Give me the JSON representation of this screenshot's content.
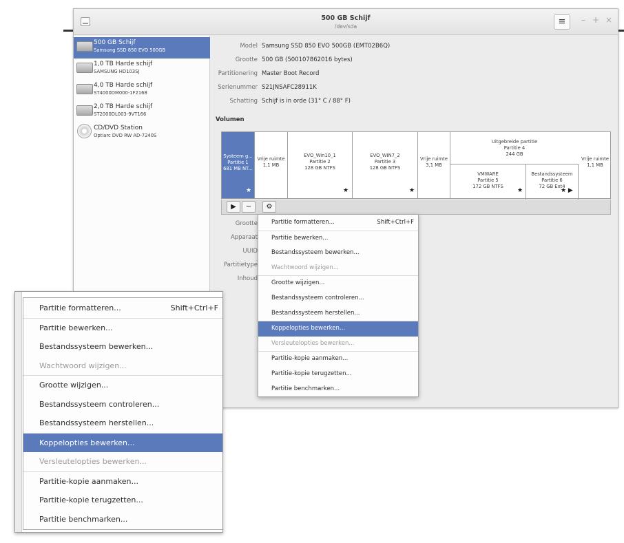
{
  "window": {
    "title": "500 GB Schijf",
    "subtitle": "/dev/sda",
    "menu_glyph": "≡",
    "controls": [
      "–",
      "+",
      "×"
    ]
  },
  "sidebar": {
    "drives": [
      {
        "name": "500 GB Schijf",
        "model": "Samsung SSD 850 EVO 500GB",
        "icon": "hard-disk-icon",
        "selected": true
      },
      {
        "name": "1,0 TB Harde schijf",
        "model": "SAMSUNG HD103SJ",
        "icon": "hard-disk-icon",
        "selected": false
      },
      {
        "name": "4,0 TB Harde schijf",
        "model": "ST4000DM000-1F2168",
        "icon": "hard-disk-icon",
        "selected": false
      },
      {
        "name": "2,0 TB Harde schijf",
        "model": "ST2000DL003-9VT166",
        "icon": "hard-disk-icon",
        "selected": false
      },
      {
        "name": "CD/DVD Station",
        "model": "Optiarc DVD RW AD-7240S",
        "icon": "optical-disc-icon",
        "selected": false
      }
    ]
  },
  "details": {
    "model_label": "Model",
    "model_value": "Samsung SSD 850 EVO 500GB (EMT02B6Q)",
    "size_label": "Grootte",
    "size_value": "500 GB (500107862016 bytes)",
    "partitioning_label": "Partitionering",
    "partitioning_value": "Master Boot Record",
    "serial_label": "Serienummer",
    "serial_value": "S21JNSAFC28911K",
    "assessment_label": "Schatting",
    "assessment_value": "Schijf is in orde (31° C / 88° F)"
  },
  "volumes": {
    "title": "Volumen",
    "segments": [
      {
        "l1": "Systeem g...",
        "l2": "Partitie 1",
        "l3": "681 MB NT...",
        "star": "★"
      },
      {
        "l1": "Vrije ruimte",
        "l2": "1,1 MB"
      },
      {
        "l1": "EVO_Win10_1",
        "l2": "Partitie 2",
        "l3": "128 GB NTFS",
        "star": "★"
      },
      {
        "l1": "EVO_WIN7_2",
        "l2": "Partitie 3",
        "l3": "128 GB NTFS",
        "star": "★"
      },
      {
        "l1": "Vrije ruimte",
        "l2": "3,1 MB"
      },
      {
        "l1": "Vrije ruimte",
        "l2": "1,1 MB"
      }
    ],
    "extended": {
      "l1": "Uitgebreide partitie",
      "l2": "Partitie 4",
      "l3": "244 GB"
    },
    "logical": [
      {
        "l1": "VMWARE",
        "l2": "Partitie 5",
        "l3": "172 GB NTFS",
        "star": "★"
      },
      {
        "l1": "Bestandssysteem",
        "l2": "Partitie 6",
        "l3": "72 GB Ext4",
        "star": "★ ▶"
      }
    ],
    "toolbar": {
      "play": "▶",
      "minus": "−",
      "gear": "⚙"
    }
  },
  "partition_details": {
    "labels": [
      "Grootte",
      "Apparaat",
      "UUID",
      "Partitietype",
      "Inhoud"
    ]
  },
  "menu": {
    "items": [
      {
        "label": "Partitie formatteren...",
        "accel": "Shift+Ctrl+F",
        "state": "normal",
        "sep_after": true
      },
      {
        "label": "Partitie bewerken...",
        "accel": "",
        "state": "normal",
        "sep_after": false
      },
      {
        "label": "Bestandssysteem bewerken...",
        "accel": "",
        "state": "normal",
        "sep_after": false
      },
      {
        "label": "Wachtwoord wijzigen...",
        "accel": "",
        "state": "disabled",
        "sep_after": true
      },
      {
        "label": "Grootte wijzigen...",
        "accel": "",
        "state": "normal",
        "sep_after": false
      },
      {
        "label": "Bestandssysteem controleren...",
        "accel": "",
        "state": "normal",
        "sep_after": false
      },
      {
        "label": "Bestandssysteem herstellen...",
        "accel": "",
        "state": "normal",
        "sep_after": true
      },
      {
        "label": "Koppelopties bewerken...",
        "accel": "",
        "state": "highlighted",
        "sep_after": false
      },
      {
        "label": "Versleutelopties bewerken...",
        "accel": "",
        "state": "disabled",
        "sep_after": true
      },
      {
        "label": "Partitie-kopie aanmaken...",
        "accel": "",
        "state": "normal",
        "sep_after": false
      },
      {
        "label": "Partitie-kopie terugzetten...",
        "accel": "",
        "state": "normal",
        "sep_after": false
      },
      {
        "label": "Partitie benchmarken...",
        "accel": "",
        "state": "normal",
        "sep_after": false
      }
    ]
  },
  "colors": {
    "accent": "#5b7abb"
  }
}
